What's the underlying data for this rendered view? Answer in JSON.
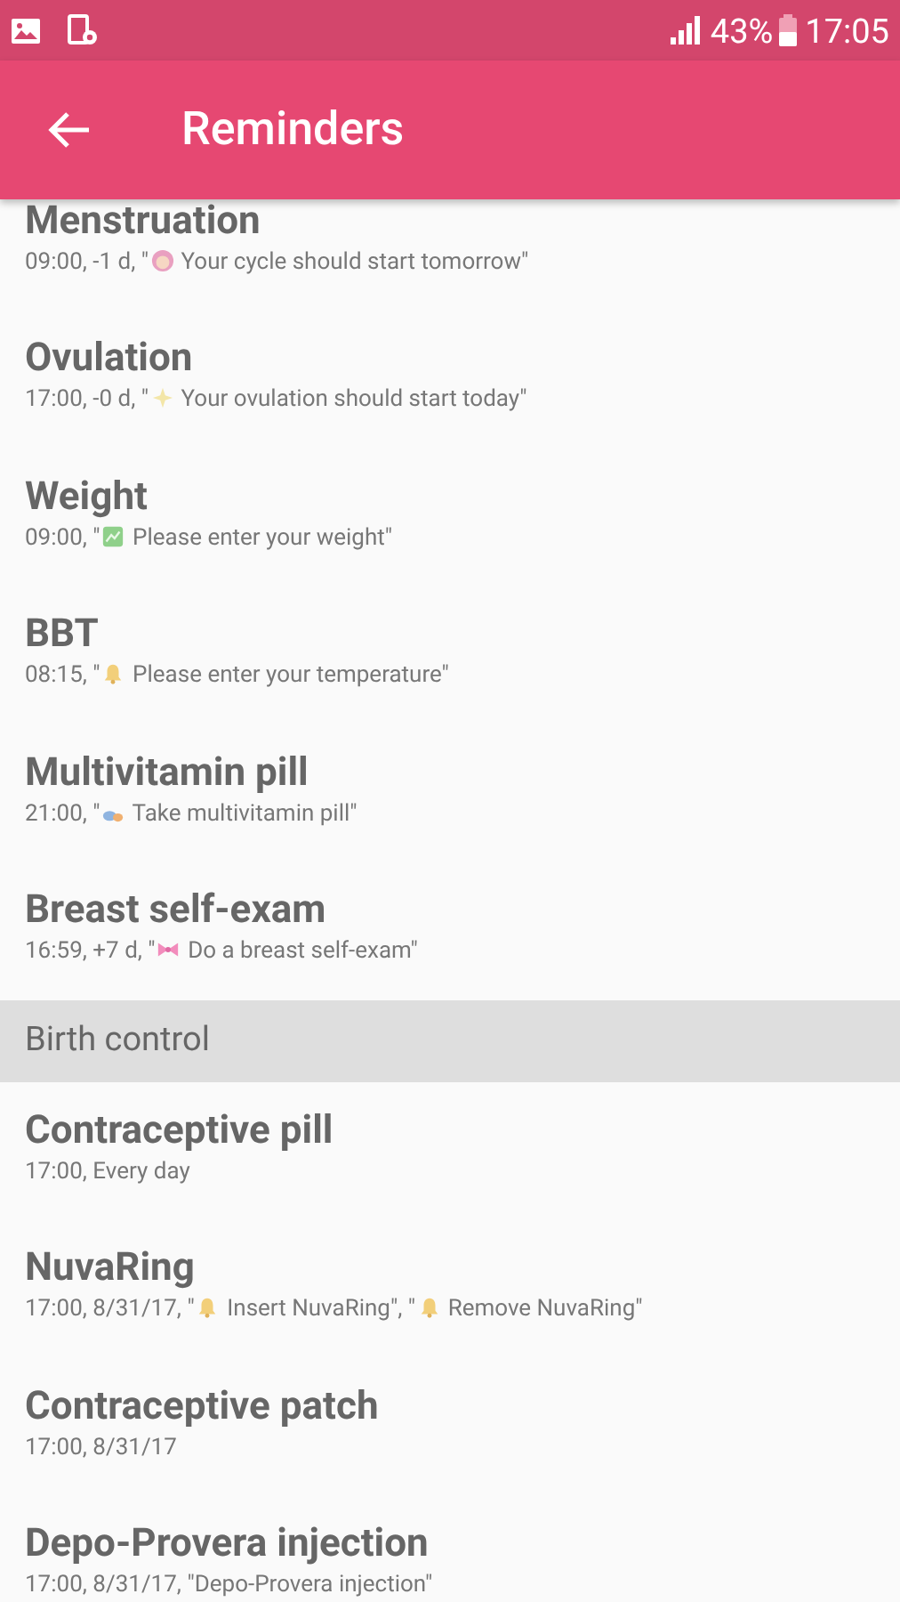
{
  "status_bar": {
    "battery": "43%",
    "time": "17:05"
  },
  "app_bar": {
    "title": "Reminders"
  },
  "sections": [
    {
      "items": [
        {
          "title": "Menstruation",
          "subtitle": [
            {
              "kind": "text",
              "text": "09:00, -1 d, \""
            },
            {
              "kind": "face"
            },
            {
              "kind": "text",
              "text": " Your cycle should start tomorrow\""
            }
          ]
        },
        {
          "title": "Ovulation",
          "subtitle": [
            {
              "kind": "text",
              "text": "17:00, -0 d, \""
            },
            {
              "kind": "sparkle"
            },
            {
              "kind": "text",
              "text": " Your ovulation should start today\""
            }
          ]
        },
        {
          "title": "Weight",
          "subtitle": [
            {
              "kind": "text",
              "text": "09:00, \""
            },
            {
              "kind": "chart"
            },
            {
              "kind": "text",
              "text": " Please enter your weight\""
            }
          ]
        },
        {
          "title": "BBT",
          "subtitle": [
            {
              "kind": "text",
              "text": "08:15, \""
            },
            {
              "kind": "bell"
            },
            {
              "kind": "text",
              "text": " Please enter your temperature\""
            }
          ]
        },
        {
          "title": "Multivitamin pill",
          "subtitle": [
            {
              "kind": "text",
              "text": "21:00, \""
            },
            {
              "kind": "pills"
            },
            {
              "kind": "text",
              "text": " Take multivitamin pill\""
            }
          ]
        },
        {
          "title": "Breast self-exam",
          "subtitle": [
            {
              "kind": "text",
              "text": "16:59, +7 d, \""
            },
            {
              "kind": "ribbon"
            },
            {
              "kind": "text",
              "text": " Do a breast self-exam\""
            }
          ]
        }
      ]
    },
    {
      "header": "Birth control",
      "items": [
        {
          "title": "Contraceptive pill",
          "subtitle": [
            {
              "kind": "text",
              "text": "17:00, Every day"
            }
          ]
        },
        {
          "title": "NuvaRing",
          "subtitle": [
            {
              "kind": "text",
              "text": "17:00, 8/31/17, \""
            },
            {
              "kind": "bell"
            },
            {
              "kind": "text",
              "text": " Insert NuvaRing\", \""
            },
            {
              "kind": "bell"
            },
            {
              "kind": "text",
              "text": " Remove NuvaRing\""
            }
          ]
        },
        {
          "title": "Contraceptive patch",
          "subtitle": [
            {
              "kind": "text",
              "text": "17:00, 8/31/17"
            }
          ]
        },
        {
          "title": "Depo-Provera injection",
          "subtitle": [
            {
              "kind": "text",
              "text": "17:00, 8/31/17, \"Depo-Provera injection\""
            }
          ]
        }
      ]
    }
  ]
}
